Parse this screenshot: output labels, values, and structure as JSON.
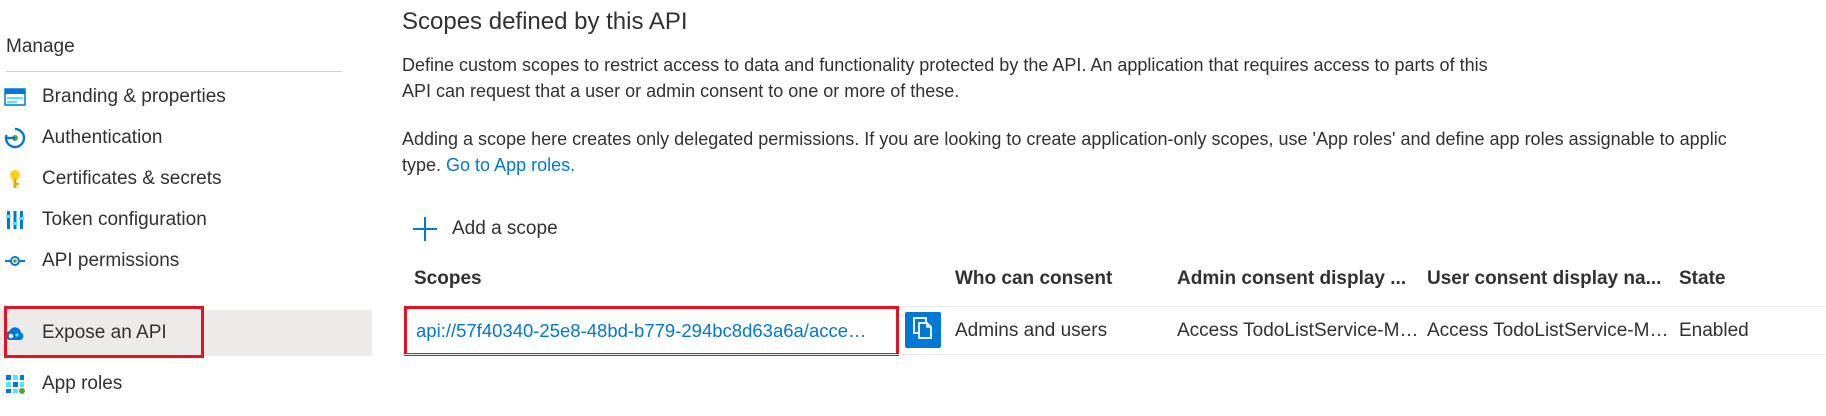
{
  "sidebar": {
    "section_title": "Manage",
    "items": [
      {
        "label": "Branding & properties",
        "icon": "branding-icon"
      },
      {
        "label": "Authentication",
        "icon": "authentication-icon"
      },
      {
        "label": "Certificates & secrets",
        "icon": "key-icon"
      },
      {
        "label": "Token configuration",
        "icon": "token-icon"
      },
      {
        "label": "API permissions",
        "icon": "api-permissions-icon"
      },
      {
        "label": "Expose an API",
        "icon": "cloud-icon",
        "active": true
      },
      {
        "label": "App roles",
        "icon": "app-roles-icon"
      }
    ]
  },
  "main": {
    "title": "Scopes defined by this API",
    "desc_line1": "Define custom scopes to restrict access to data and functionality protected by the API. An application that requires access to parts of this",
    "desc_line2": "API can request that a user or admin consent to one or more of these.",
    "note_line1": "Adding a scope here creates only delegated permissions. If you are looking to create application-only scopes, use 'App roles' and define app roles assignable to applic",
    "note_line2_prefix": "type.",
    "note_link": "Go to App roles.",
    "add_scope_label": "Add a scope",
    "table": {
      "columns": [
        "Scopes",
        "Who can consent",
        "Admin consent display ...",
        "User consent display na...",
        "State"
      ],
      "rows": [
        {
          "scope": "api://57f40340-25e8-48bd-b779-294bc8d63a6a/acce…",
          "who": "Admins and users",
          "admin": "Access TodoListService-M…",
          "user": "Access TodoListService-M…",
          "state": "Enabled"
        }
      ]
    }
  },
  "colors": {
    "accent": "#0078d4",
    "highlight": "#e81123",
    "active_bg": "#edebe9"
  }
}
